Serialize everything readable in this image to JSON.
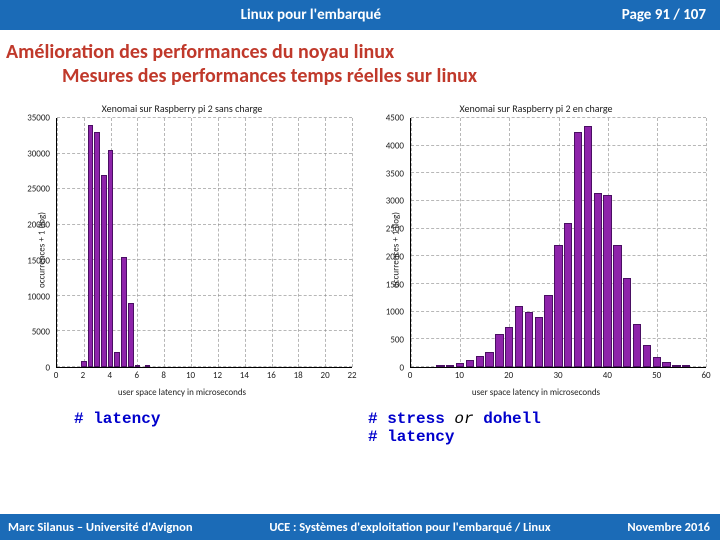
{
  "header": {
    "title": "Linux pour l'embarqué",
    "pager": "Page 91 / 107"
  },
  "heading": {
    "h1": "Amélioration des performances du noyau linux",
    "h2": "Mesures des performances temps réelles sur linux"
  },
  "chart_data": [
    {
      "type": "bar",
      "title": "Xenomai sur Raspberry pi 2 sans charge",
      "xlabel": "user space latency in microseconds",
      "ylabel": "occurrences + 1 (log)",
      "xticks": [
        0,
        2,
        4,
        6,
        8,
        10,
        12,
        14,
        16,
        18,
        20,
        22
      ],
      "yticks": [
        0,
        5000,
        10000,
        15000,
        20000,
        25000,
        30000,
        35000
      ],
      "xlim": [
        0,
        22
      ],
      "ylim": [
        0,
        35000
      ],
      "categories": [
        2,
        2.5,
        3,
        3.5,
        4,
        4.5,
        5,
        5.5,
        6,
        6.75
      ],
      "values": [
        900,
        34000,
        33000,
        27000,
        30500,
        2100,
        15500,
        9000,
        300,
        150
      ]
    },
    {
      "type": "bar",
      "title": "Xenomai sur Raspberry pi 2 en charge",
      "xlabel": "user space latency in microseconds",
      "ylabel": "occurrences + 1 (log)",
      "xticks": [
        0,
        10,
        20,
        30,
        40,
        50,
        60
      ],
      "yticks": [
        0,
        500,
        1000,
        1500,
        2000,
        2500,
        3000,
        3500,
        4000,
        4500
      ],
      "xlim": [
        0,
        60
      ],
      "ylim": [
        0,
        4500
      ],
      "categories": [
        6,
        8,
        10,
        12,
        14,
        16,
        18,
        20,
        22,
        24,
        26,
        28,
        30,
        32,
        34,
        36,
        38,
        40,
        42,
        44,
        46,
        48,
        50,
        52,
        54,
        56
      ],
      "values": [
        20,
        40,
        80,
        120,
        200,
        280,
        600,
        720,
        1100,
        1000,
        900,
        1300,
        2200,
        2600,
        4250,
        4350,
        3150,
        3100,
        2200,
        1600,
        780,
        400,
        180,
        90,
        40,
        20
      ]
    }
  ],
  "captions": {
    "left": [
      {
        "t": "# ",
        "c": "kw"
      },
      {
        "t": "latency",
        "c": "kw"
      }
    ],
    "right_l1": [
      {
        "t": "# ",
        "c": "kw"
      },
      {
        "t": "stress ",
        "c": "kw"
      },
      {
        "t": "or ",
        "c": "norm"
      },
      {
        "t": "dohell",
        "c": "kw"
      }
    ],
    "right_l2": [
      {
        "t": "# ",
        "c": "kw"
      },
      {
        "t": "latency",
        "c": "kw"
      }
    ]
  },
  "footer": {
    "left": "Marc Silanus – Université d'Avignon",
    "center": "UCE : Systèmes d'exploitation pour l'embarqué / Linux",
    "right": "Novembre 2016"
  }
}
